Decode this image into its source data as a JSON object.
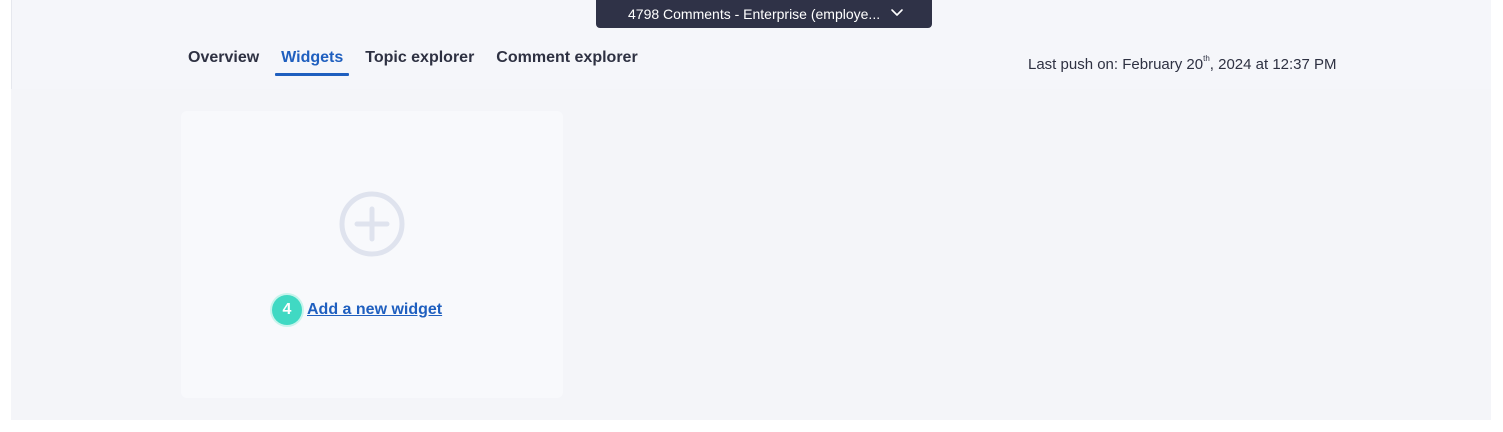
{
  "dataset_selector": {
    "label": "4798 Comments - Enterprise (employe...",
    "icon": "chevron-down-icon"
  },
  "tabs": [
    {
      "label": "Overview",
      "active": false
    },
    {
      "label": "Widgets",
      "active": true
    },
    {
      "label": "Topic explorer",
      "active": false
    },
    {
      "label": "Comment explorer",
      "active": false
    }
  ],
  "last_push": {
    "prefix": "Last push on: February 20",
    "suffix": "th",
    "rest": ", 2024 at 12:37 PM"
  },
  "widget_card": {
    "icon": "plus-circle-icon",
    "step_number": "4",
    "add_label": "Add a new widget"
  },
  "colors": {
    "accent": "#1f5fbf",
    "pill_bg": "#2f3247",
    "badge": "#40d9c3",
    "page_bg": "#f4f5f9"
  }
}
